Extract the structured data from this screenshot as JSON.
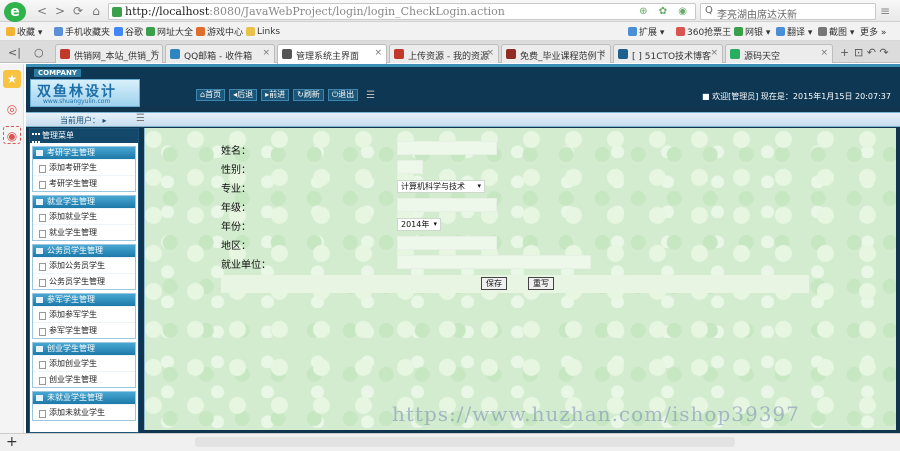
{
  "browser": {
    "logo_char": "e",
    "back": "<",
    "forward": ">",
    "reload": "⟳",
    "home": "⌂",
    "url_host": "http://localhost",
    "url_path": ":8080/JavaWebProject/login/login_CheckLogin.action",
    "url_icons": "⊕ ✿ ◉",
    "search_text": "李亮湖由席达沃新",
    "search_icon": "Q",
    "search_btn": "≡",
    "bookmarks": [
      {
        "label": "收藏 ▾",
        "color": "#f3b333"
      },
      {
        "label": "手机收藏夹",
        "color": "#5b8fd9"
      },
      {
        "label": "谷歌",
        "color": "#4285f4"
      },
      {
        "label": "网址大全",
        "color": "#3aa04a"
      },
      {
        "label": "游戏中心",
        "color": "#e06d2c"
      },
      {
        "label": "Links",
        "color": "#e8c24a"
      }
    ],
    "right_bookmarks": [
      {
        "label": "扩展 ▾",
        "color": "#4a8ed6"
      },
      {
        "label": "360抢票王",
        "color": "#d9534f"
      },
      {
        "label": "网银 ▾",
        "color": "#3aa04a"
      },
      {
        "label": "翻译 ▾",
        "color": "#4a8ed6"
      },
      {
        "label": "截图 ▾",
        "color": "#777777"
      },
      {
        "label": "更多 »",
        "color": "#999999"
      }
    ],
    "tabs": [
      {
        "label": "供销网_本站_供销_万",
        "color": "#c0392b",
        "active": false
      },
      {
        "label": "QQ邮箱 - 收件箱",
        "color": "#2e86c1",
        "active": false
      },
      {
        "label": "管理系统主界面",
        "color": "#555555",
        "active": true
      },
      {
        "label": "上传资源 - 我的资源",
        "color": "#c0392b",
        "active": false
      },
      {
        "label": "免费_毕业课程范例下",
        "color": "#922b21",
        "active": false
      },
      {
        "label": "[ ] 51CTO技术博客",
        "color": "#1f618d",
        "active": false
      },
      {
        "label": "源码天空",
        "color": "#27ae60",
        "active": false
      }
    ],
    "tabbar_prev": "<|",
    "tabbar_refresh": "○",
    "tab_close": "×",
    "new_tab": "+",
    "tabbar_right": "⊡ ↶ ↷",
    "add_tab_bottom": "+"
  },
  "app": {
    "company": "COMPANY",
    "logo_text": "双鱼林设计",
    "logo_sub": "www.shuangyulin.com",
    "topnav": [
      "首页",
      "后退",
      "前进",
      "刷新",
      "退出"
    ],
    "menu_icon": "☰",
    "welcome": "■ 欢迎[管理员]    现在是：2015年1月15日  20:07:37",
    "current_user": "当前用户： ▸",
    "menu_title": "管理菜单",
    "groups": [
      {
        "title": "考研学生管理",
        "items": [
          "添加考研学生",
          "考研学生管理"
        ]
      },
      {
        "title": "就业学生管理",
        "items": [
          "添加就业学生",
          "就业学生管理"
        ]
      },
      {
        "title": "公务员学生管理",
        "items": [
          "添加公务员学生",
          "公务员学生管理"
        ]
      },
      {
        "title": "参军学生管理",
        "items": [
          "添加参军学生",
          "参军学生管理"
        ]
      },
      {
        "title": "创业学生管理",
        "items": [
          "添加创业学生",
          "创业学生管理"
        ]
      },
      {
        "title": "未就业学生管理",
        "items": [
          "添加未就业学生"
        ]
      }
    ],
    "form": {
      "name_label": "姓名：",
      "gender_label": "性别：",
      "major_label": "专业：",
      "major_value": "计算机科学与技术",
      "grade_label": "年级：",
      "year_label": "年份：",
      "year_value": "2014年",
      "region_label": "地区：",
      "employer_label": "就业单位：",
      "save_btn": "保存",
      "reset_btn": "重写",
      "caret": "▾"
    }
  },
  "watermark": "https://www.huzhan.com/ishop39397"
}
